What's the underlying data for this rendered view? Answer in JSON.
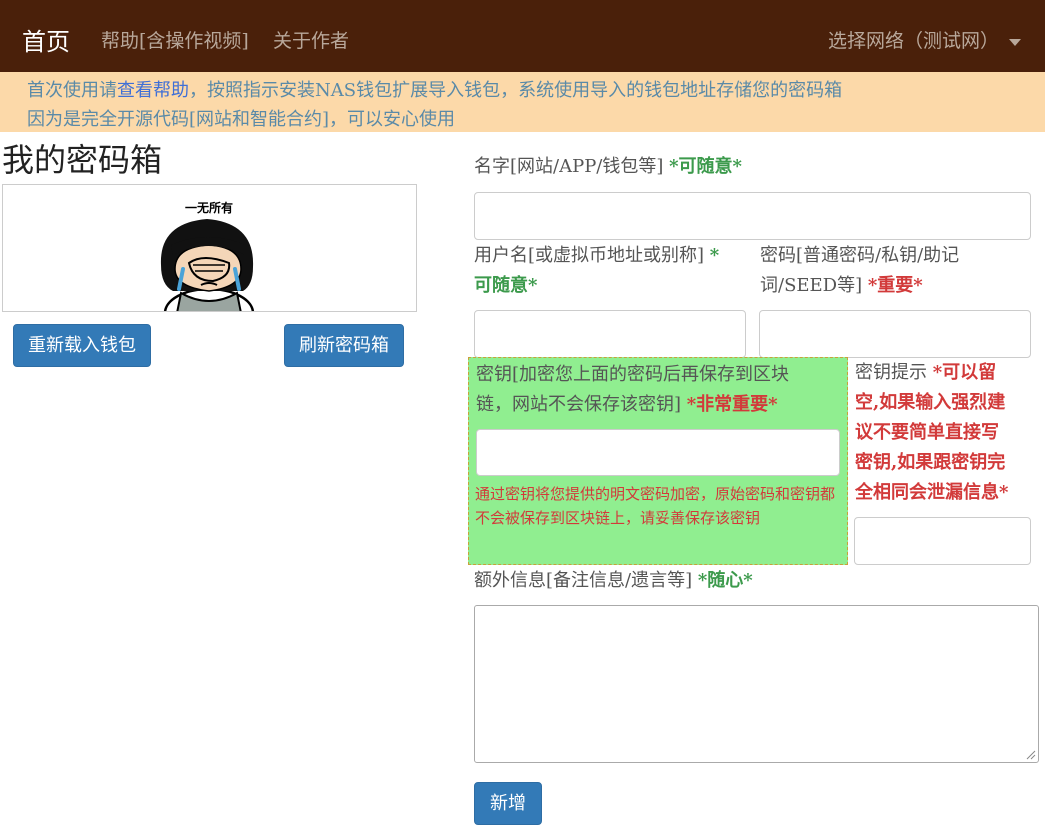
{
  "nav": {
    "brand": "首页",
    "help": "帮助[含操作视频]",
    "about": "关于作者",
    "network": "选择网络（测试网）"
  },
  "notice": {
    "line1_prefix": "首次使用请",
    "line1_link": "查看帮助",
    "line1_suffix": "，按照指示安装NAS钱包扩展导入钱包，系统使用导入的钱包地址存储您的密码箱",
    "line2": "因为是完全开源代码[网站和智能合约]，可以安心使用"
  },
  "left": {
    "title": "我的密码箱",
    "image_caption": "一无所有",
    "reload_button": "重新载入钱包",
    "refresh_button": "刷新密码箱"
  },
  "form": {
    "name_label": "名字[网站/APP/钱包等]",
    "name_tag": "*可随意*",
    "username_label": "用户名[或虚拟币地址或别称]",
    "username_tag_a": "*",
    "username_tag_b": "可随意*",
    "password_label_a": "密码[普通密码/私钥/助记",
    "password_label_b": "词/SEED等]",
    "password_tag": "*重要*",
    "key_label_a": "密钥[加密您上面的密码后再保存到区块",
    "key_label_b": "链，网站不会保存该密钥]",
    "key_tag": "*非常重要*",
    "key_hint_text": "通过密钥将您提供的明文密码加密，原始密码和密钥都不会被保存到区块链上，请妥善保存该密钥",
    "keyhint_label": "密钥提示",
    "keyhint_tag_1": "*可以留",
    "keyhint_tag_2": "空,如果输入强烈建",
    "keyhint_tag_3": "议不要简单直接写",
    "keyhint_tag_4": "密钥,如果跟密钥完",
    "keyhint_tag_5": "全相同会泄漏信息*",
    "extra_label": "额外信息[备注信息/遗言等]",
    "extra_tag": "*随心*",
    "add_button": "新增"
  },
  "colors": {
    "navbar": "#4a200a",
    "notice_bg": "#fcd9a9",
    "primary": "#337ab7",
    "key_panel": "#90ee90",
    "green_tag": "#3c9a4c",
    "red_tag": "#d23a3a"
  }
}
